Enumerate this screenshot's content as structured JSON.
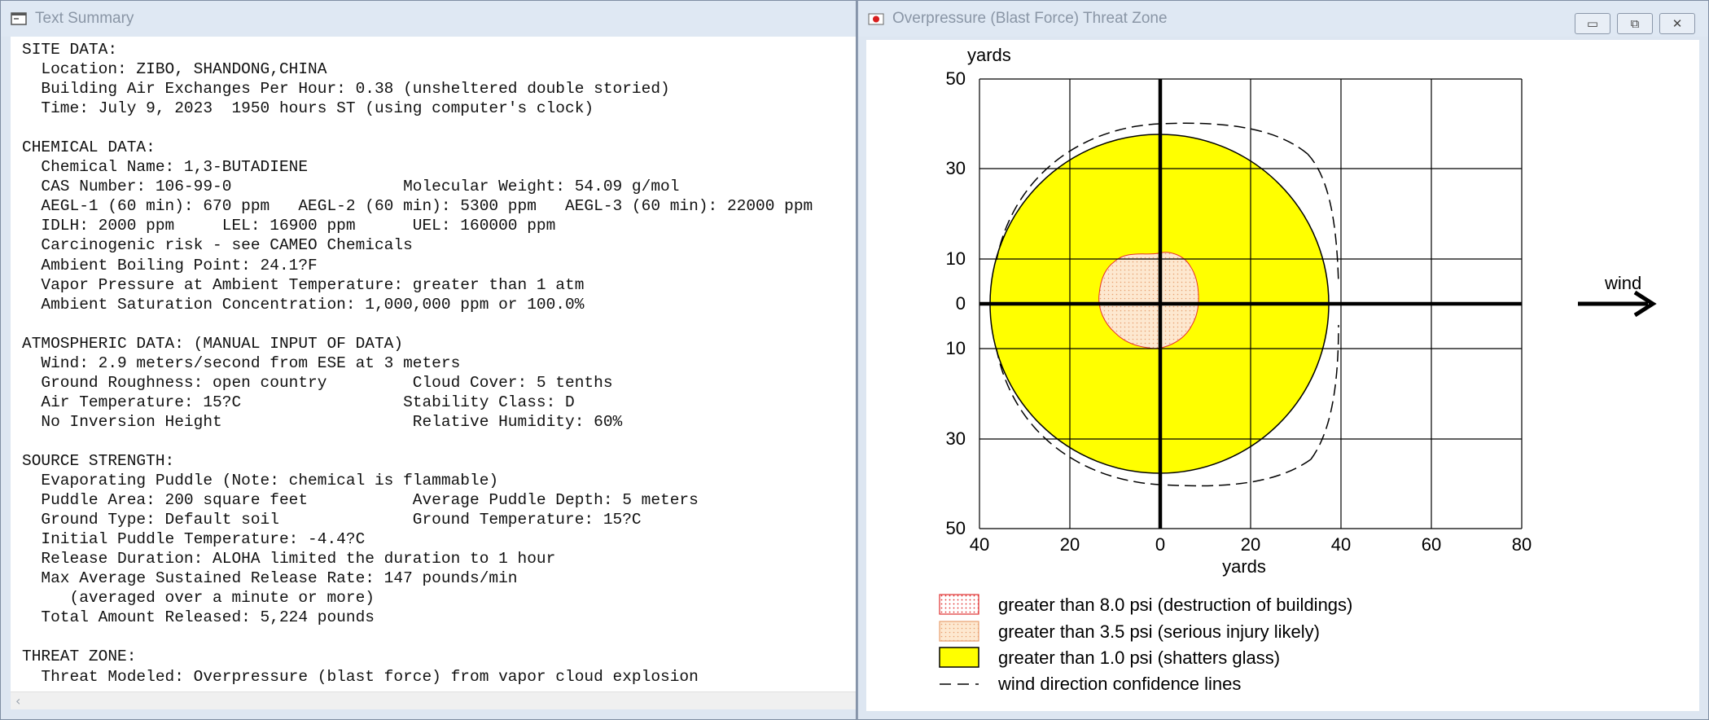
{
  "left_window": {
    "title": "Text Summary",
    "lines": [
      "SITE DATA:",
      "  Location: ZIBO, SHANDONG,CHINA",
      "  Building Air Exchanges Per Hour: 0.38 (unsheltered double storied)",
      "  Time: July 9, 2023  1950 hours ST (using computer's clock)",
      "",
      "CHEMICAL DATA:",
      "  Chemical Name: 1,3-BUTADIENE",
      "  CAS Number: 106-99-0                  Molecular Weight: 54.09 g/mol",
      "  AEGL-1 (60 min): 670 ppm   AEGL-2 (60 min): 5300 ppm   AEGL-3 (60 min): 22000 ppm",
      "  IDLH: 2000 ppm     LEL: 16900 ppm      UEL: 160000 ppm",
      "  Carcinogenic risk - see CAMEO Chemicals",
      "  Ambient Boiling Point: 24.1?F",
      "  Vapor Pressure at Ambient Temperature: greater than 1 atm",
      "  Ambient Saturation Concentration: 1,000,000 ppm or 100.0%",
      "",
      "ATMOSPHERIC DATA: (MANUAL INPUT OF DATA)",
      "  Wind: 2.9 meters/second from ESE at 3 meters",
      "  Ground Roughness: open country         Cloud Cover: 5 tenths",
      "  Air Temperature: 15?C                 Stability Class: D",
      "  No Inversion Height                    Relative Humidity: 60%",
      "",
      "SOURCE STRENGTH:",
      "  Evaporating Puddle (Note: chemical is flammable)",
      "  Puddle Area: 200 square feet           Average Puddle Depth: 5 meters",
      "  Ground Type: Default soil              Ground Temperature: 15?C",
      "  Initial Puddle Temperature: -4.4?C",
      "  Release Duration: ALOHA limited the duration to 1 hour",
      "  Max Average Sustained Release Rate: 147 pounds/min",
      "     (averaged over a minute or more)",
      "  Total Amount Released: 5,224 pounds",
      "",
      "THREAT ZONE:",
      "  Threat Modeled: Overpressure (blast force) from vapor cloud explosion"
    ],
    "scroll_left_arrow": "‹"
  },
  "right_window": {
    "title": "Overpressure (Blast Force) Threat Zone",
    "buttons": {
      "minimize": "▭",
      "maximize": "⧉",
      "close": "✕"
    },
    "plot": {
      "y_unit_label": "yards",
      "x_unit_label": "yards",
      "x_ticks": [
        "40",
        "20",
        "0",
        "20",
        "40",
        "60",
        "80"
      ],
      "y_ticks": [
        "50",
        "30",
        "10",
        "0",
        "10",
        "30",
        "50"
      ],
      "wind_label": "wind"
    },
    "legend": [
      {
        "label": "greater than 8.0 psi (destruction of buildings)",
        "swatch": "red-dots"
      },
      {
        "label": "greater than 3.5 psi (serious injury likely)",
        "swatch": "orange-dots"
      },
      {
        "label": "greater than 1.0 psi (shatters glass)",
        "swatch": "yellow"
      },
      {
        "label": "wind direction confidence lines",
        "swatch": "dashed-line"
      }
    ],
    "colors": {
      "zone_1psi": "#ffff00",
      "zone_3_5psi": "#fbe3c8",
      "zone_8psi_outline": "#e8322b",
      "grid": "#000000"
    }
  }
}
